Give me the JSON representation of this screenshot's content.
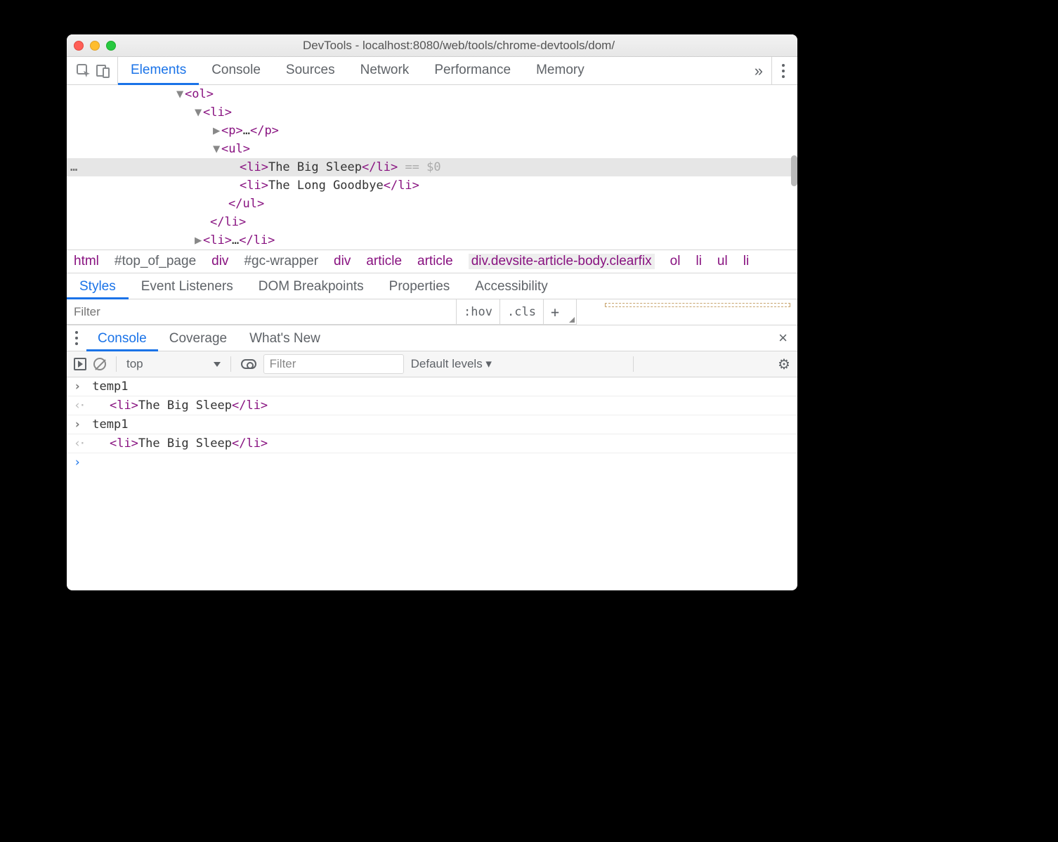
{
  "titlebar": {
    "title": "DevTools - localhost:8080/web/tools/chrome-devtools/dom/"
  },
  "tabs": {
    "items": [
      "Elements",
      "Console",
      "Sources",
      "Network",
      "Performance",
      "Memory"
    ],
    "activeIndex": 0,
    "overflow": "»"
  },
  "dom": {
    "lines": [
      {
        "indent": 156,
        "caret": "▼",
        "open": "<ol>",
        "selected": false
      },
      {
        "indent": 182,
        "caret": "▼",
        "open": "<li>",
        "selected": false
      },
      {
        "indent": 208,
        "caret": "▶",
        "open": "<p>",
        "mid": "…",
        "close": "</p>",
        "selected": false
      },
      {
        "indent": 208,
        "caret": "▼",
        "open": "<ul>",
        "selected": false
      },
      {
        "indent": 234,
        "caret": "",
        "open": "<li>",
        "mid": "The Big Sleep",
        "close": "</li>",
        "tail": " == $0",
        "selected": true
      },
      {
        "indent": 234,
        "caret": "",
        "open": "<li>",
        "mid": "The Long Goodbye",
        "close": "</li>",
        "selected": false
      },
      {
        "indent": 218,
        "caret": "",
        "open": "</ul>",
        "selected": false
      },
      {
        "indent": 192,
        "caret": "",
        "open": "</li>",
        "selected": false
      },
      {
        "indent": 182,
        "caret": "▶",
        "open": "<li>",
        "mid": "…",
        "close": "</li>",
        "selected": false
      }
    ],
    "ellipsis": "…"
  },
  "crumbs": {
    "items": [
      {
        "t": "html",
        "sel": true
      },
      {
        "t": "#top_of_page"
      },
      {
        "t": "div",
        "sel": true
      },
      {
        "t": "#gc-wrapper"
      },
      {
        "t": "div",
        "sel": true
      },
      {
        "t": "article",
        "sel": true
      },
      {
        "t": "article",
        "sel": true
      },
      {
        "t": "div.devsite-article-body.clearfix",
        "hi": true
      },
      {
        "t": "ol",
        "sel": true
      },
      {
        "t": "li",
        "sel": true
      },
      {
        "t": "ul",
        "sel": true
      },
      {
        "t": "li",
        "sel": true
      }
    ]
  },
  "styles": {
    "tabs": [
      "Styles",
      "Event Listeners",
      "DOM Breakpoints",
      "Properties",
      "Accessibility"
    ],
    "activeIndex": 0,
    "filterPlaceholder": "Filter",
    "hov": ":hov",
    "cls": ".cls",
    "plus": "+"
  },
  "drawer": {
    "tabs": [
      "Console",
      "Coverage",
      "What's New"
    ],
    "activeIndex": 0,
    "context": "top",
    "filterPlaceholder": "Filter",
    "levels": "Default levels ▾",
    "gear": "⚙",
    "close": "×",
    "lines": [
      {
        "kind": "in",
        "text": "temp1"
      },
      {
        "kind": "out",
        "open": "<li>",
        "mid": "The Big Sleep",
        "close": "</li>"
      },
      {
        "kind": "in",
        "text": "temp1"
      },
      {
        "kind": "out",
        "open": "<li>",
        "mid": "The Big Sleep",
        "close": "</li>"
      }
    ],
    "prompt": "›"
  }
}
